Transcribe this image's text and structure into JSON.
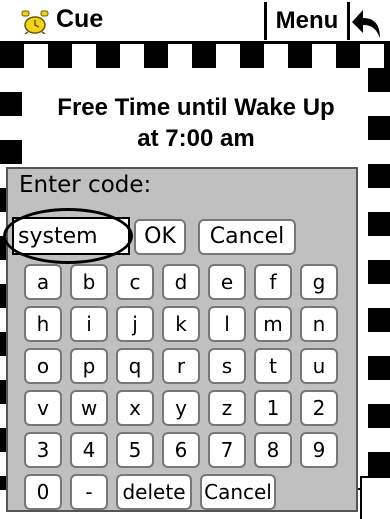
{
  "title_bar": {
    "app_title": "Cue",
    "menu_label": "Menu",
    "icons": {
      "app": "alarm-clock-icon",
      "back": "back-arrow-icon"
    }
  },
  "cue": {
    "line1": "Free Time until Wake Up",
    "line2": "at 7:00 am"
  },
  "dialog": {
    "label": "Enter code:",
    "input_value": "system",
    "ok_label": "OK",
    "cancel_label": "Cancel"
  },
  "keypad": {
    "rows": [
      [
        "a",
        "b",
        "c",
        "d",
        "e",
        "f",
        "g"
      ],
      [
        "h",
        "i",
        "j",
        "k",
        "l",
        "m",
        "n"
      ],
      [
        "o",
        "p",
        "q",
        "r",
        "s",
        "t",
        "u"
      ],
      [
        "v",
        "w",
        "x",
        "y",
        "z",
        "1",
        "2"
      ],
      [
        "3",
        "4",
        "5",
        "6",
        "7",
        "8",
        "9"
      ],
      [
        "0",
        "-",
        "delete",
        "Cancel"
      ]
    ]
  },
  "colors": {
    "dialog_bg": "#c0c0c0",
    "border": "#000000"
  }
}
